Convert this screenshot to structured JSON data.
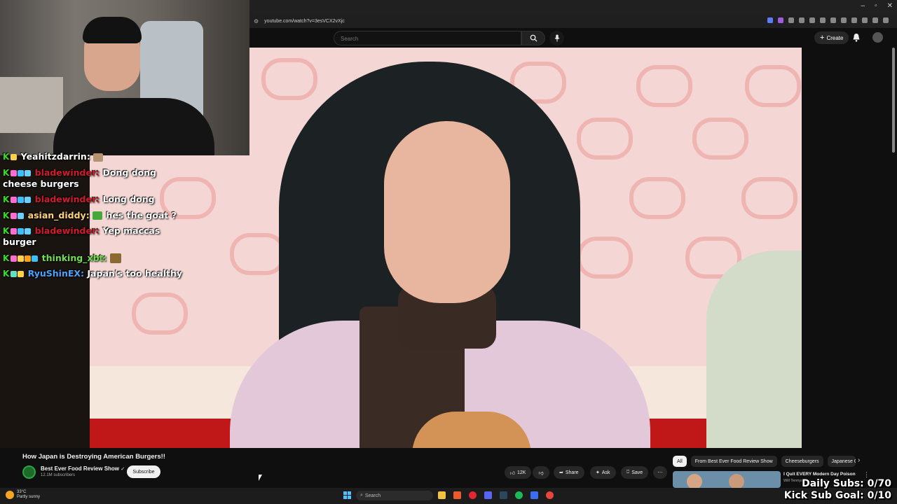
{
  "browser": {
    "url": "youtube.com/watch?v=3esVCX2vXjc"
  },
  "youtube_header": {
    "search_placeholder": "Search",
    "create_label": "Create"
  },
  "chat": {
    "messages": [
      {
        "user": "Yeahitzdarrin:",
        "user_color": "#ffffff",
        "text": "",
        "emote": true
      },
      {
        "user": "bladewinder:",
        "user_color": "#d11a2a",
        "text": "Dong dong cheese burgers"
      },
      {
        "user": "bladewinder:",
        "user_color": "#d11a2a",
        "text": "Long dong"
      },
      {
        "user": "asian_diddy:",
        "user_color": "#ffd27a",
        "text": "hes the goat ?",
        "emote": true
      },
      {
        "user": "bladewinder:",
        "user_color": "#d11a2a",
        "text": "Yep maccas burger"
      },
      {
        "user": "thinking_xbt:",
        "user_color": "#6fe04a",
        "text": "",
        "emote": true
      },
      {
        "user": "RyuShinEX:",
        "user_color": "#4aa3ff",
        "text": "Japan's too healthy"
      }
    ]
  },
  "video": {
    "title": "How Japan is Destroying American Burgers!!",
    "channel": "Best Ever Food Review Show",
    "subscribers": "12.1M subscribers",
    "subscribe_label": "Subscribe",
    "likes": "12K",
    "share_label": "Share",
    "ask_label": "Ask",
    "save_label": "Save"
  },
  "chips": [
    "All",
    "From Best Ever Food Review Show",
    "Cheeseburgers",
    "Japanese C"
  ],
  "recommendation": {
    "title": "I Quit EVERY Modern Day Poison",
    "channel": "Will Tennyson"
  },
  "taskbar": {
    "temperature": "33°C",
    "weather": "Partly sunny",
    "search_label": "Search"
  },
  "overlay": {
    "daily_subs": "Daily Subs: 0/70",
    "kick_goal": "Kick Sub Goal: 0/10"
  }
}
